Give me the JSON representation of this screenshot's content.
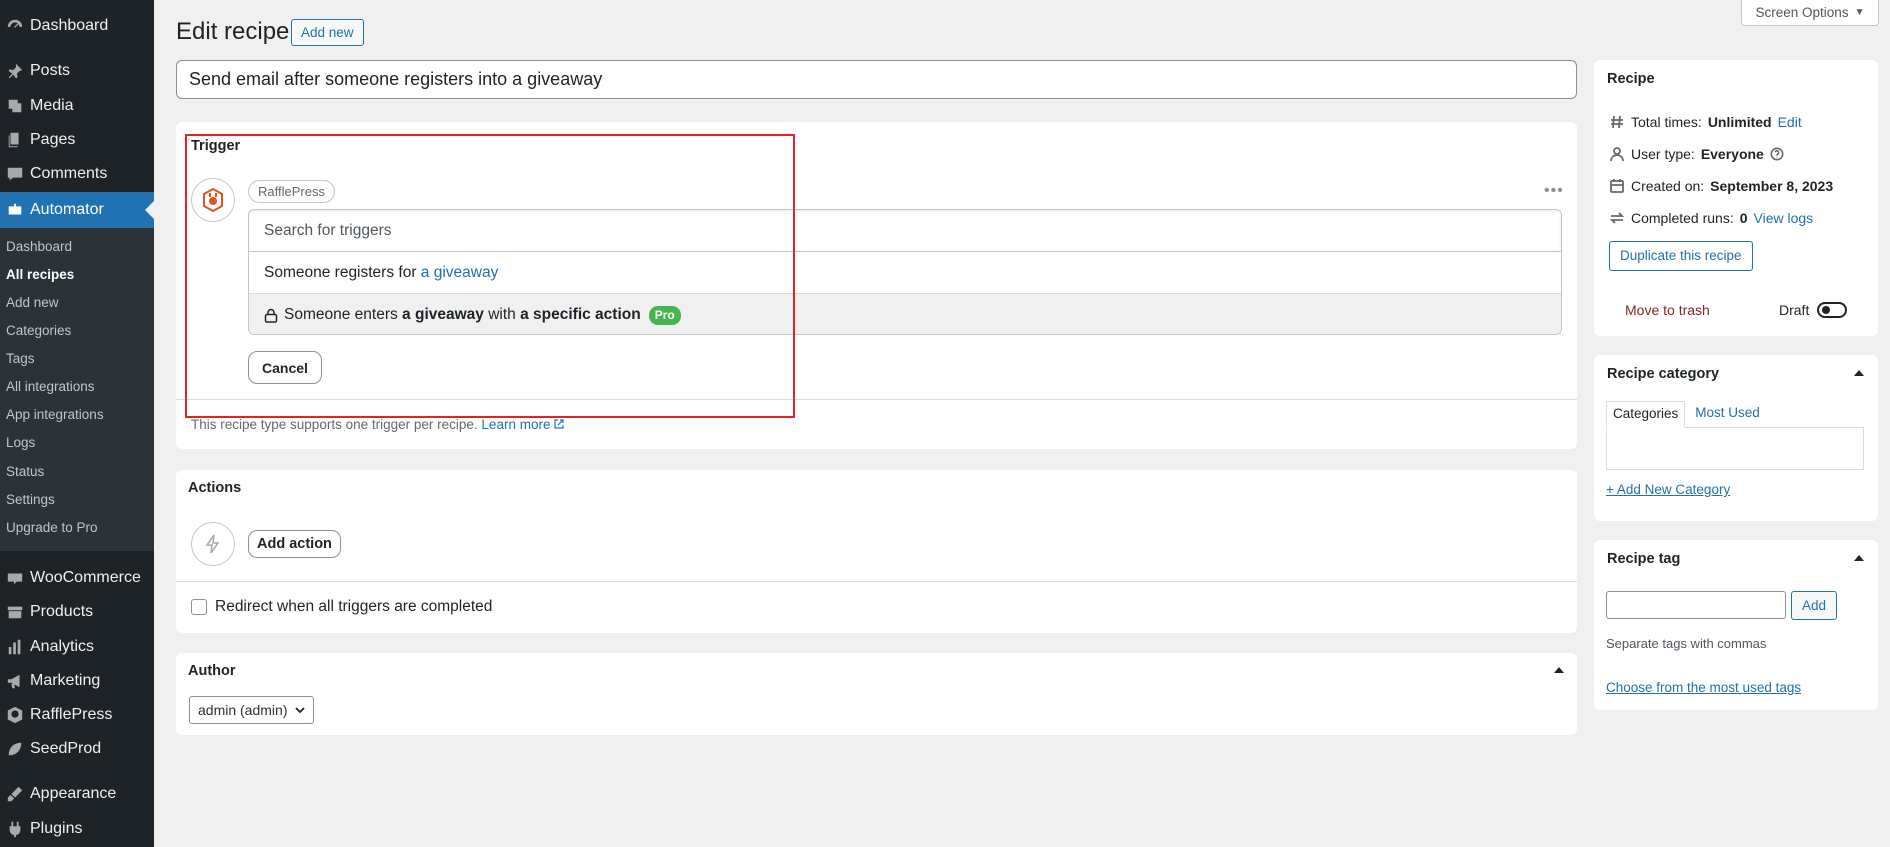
{
  "sidebar": {
    "menu": [
      {
        "label": "Dashboard",
        "icon": "dashboard-icon"
      },
      {
        "label": "Posts",
        "icon": "pin-icon"
      },
      {
        "label": "Media",
        "icon": "media-icon"
      },
      {
        "label": "Pages",
        "icon": "pages-icon"
      },
      {
        "label": "Comments",
        "icon": "comment-icon"
      },
      {
        "label": "Automator",
        "icon": "robot-icon"
      },
      {
        "label": "WooCommerce",
        "icon": "woo-icon"
      },
      {
        "label": "Products",
        "icon": "box-icon"
      },
      {
        "label": "Analytics",
        "icon": "bar-chart-icon"
      },
      {
        "label": "Marketing",
        "icon": "megaphone-icon"
      },
      {
        "label": "RafflePress",
        "icon": "raffle-icon"
      },
      {
        "label": "SeedProd",
        "icon": "leaf-icon"
      },
      {
        "label": "Appearance",
        "icon": "brush-icon"
      },
      {
        "label": "Plugins",
        "icon": "plug-icon"
      }
    ],
    "submenu": [
      "Dashboard",
      "All recipes",
      "Add new",
      "Categories",
      "Tags",
      "All integrations",
      "App integrations",
      "Logs",
      "Status",
      "Settings",
      "Upgrade to Pro"
    ]
  },
  "header": {
    "title": "Edit recipe",
    "add_new": "Add new",
    "screen_options": "Screen Options"
  },
  "recipe_title": "Send email after someone registers into a giveaway",
  "trigger": {
    "heading": "Trigger",
    "integration": "RafflePress",
    "search_placeholder": "Search for triggers",
    "option1_prefix": "Someone registers for ",
    "option1_link": "a giveaway",
    "option2_a": "Someone enters ",
    "option2_b": "a giveaway",
    "option2_c": " with ",
    "option2_d": "a specific action",
    "pro_badge": "Pro",
    "cancel": "Cancel",
    "note": "This recipe type supports one trigger per recipe.",
    "learn_more": "Learn more"
  },
  "actions": {
    "heading": "Actions",
    "add_action": "Add action",
    "redirect_label": "Redirect when all triggers are completed"
  },
  "author": {
    "heading": "Author",
    "selected": "admin (admin)"
  },
  "recipe_box": {
    "heading": "Recipe",
    "total_times_label": "Total times:",
    "total_times_value": "Unlimited",
    "edit": "Edit",
    "user_type_label": "User type:",
    "user_type_value": "Everyone",
    "created_label": "Created on:",
    "created_value": "September 8, 2023",
    "runs_label": "Completed runs:",
    "runs_value": "0",
    "view_logs": "View logs",
    "duplicate": "Duplicate this recipe",
    "trash": "Move to trash",
    "status": "Draft"
  },
  "category_box": {
    "heading": "Recipe category",
    "tab_all": "Categories",
    "tab_most": "Most Used",
    "add_new": "+ Add New Category"
  },
  "tag_box": {
    "heading": "Recipe tag",
    "add": "Add",
    "hint": "Separate tags with commas",
    "most_used": "Choose from the most used tags"
  },
  "colors": {
    "accent": "#2271b1",
    "sidebar": "#1d2327",
    "highlight": "#e02424",
    "pro": "#46b450"
  }
}
